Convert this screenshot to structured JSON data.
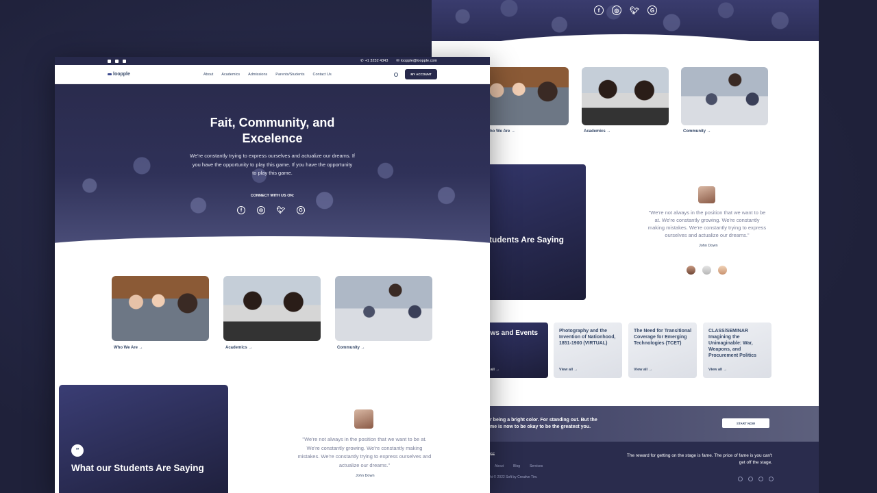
{
  "front": {
    "topbar": {
      "phone": "+1 3232 4343",
      "email": "loopple@loopple.com"
    },
    "nav": {
      "logo": "loopple",
      "menu": [
        "About",
        "Academics",
        "Admissions",
        "Parents/Students",
        "Contact Us"
      ],
      "account_button": "MY ACCOUNT"
    },
    "hero": {
      "title_line1": "Fait, Community, and",
      "title_line2": "Excelence",
      "subtitle": "We're constantly trying to express ourselves and actualize our dreams. If you have the opportunity to play this game. If you have the opportunity to play this game.",
      "connect": "CONNECT WITH US ON:",
      "social_icons": [
        "facebook-icon",
        "instagram-icon",
        "twitter-icon",
        "google-plus-icon"
      ]
    },
    "cards": [
      {
        "label": "Who We Are →"
      },
      {
        "label": "Academics →"
      },
      {
        "label": "Community →"
      }
    ],
    "testimonials": {
      "title": "What our Students Are Saying",
      "quote_icon": "quote-icon",
      "quote": "\"We're not always in the position that we want to be at. We're constantly growing. We're constantly making mistakes. We're constantly trying to express ourselves and actualize our dreams.\"",
      "name": "John Down"
    }
  },
  "back": {
    "cards": [
      {
        "label": "ho We Are →"
      },
      {
        "label": "Academics →"
      },
      {
        "label": "Community →"
      }
    ],
    "testimonials": {
      "title": "tudents Are Saying",
      "quote": "\"We're not always in the position that we want to be at. We're constantly growing. We're constantly making mistakes. We're constantly trying to express ourselves and actualize our dreams.\"",
      "name": "John Down"
    },
    "events": {
      "title": "ews and Events",
      "view_all_first": "w all →",
      "items": [
        {
          "title": "Photography and the Invention of Nationhood, 1851-1900 (VIRTUAL)",
          "link": "View all →"
        },
        {
          "title": "The Need for Transitional Coverage for Emerging Technologies (TCET)",
          "link": "View all →"
        },
        {
          "title": "CLASS/SEMINAR Imagining the Unimaginable: War, Weapons, and Procurement Politics",
          "link": "View all →"
        }
      ]
    },
    "cta": {
      "line1": "r being a bright color. For standing out. But the",
      "line2": "me is now to be okay to be the greatest you.",
      "button": "START NOW"
    },
    "footer": {
      "label": "GE",
      "links": [
        "About",
        "Blog",
        "Services"
      ],
      "copyright": "ht © 2022 Soft by Creative Tim.",
      "quote": "The reward for getting on the stage is fame. The price of fame is you can't get off the stage."
    }
  },
  "colors": {
    "background": "#22243f",
    "navy": "#27294b",
    "text": "#344767",
    "muted": "#7b809a"
  }
}
